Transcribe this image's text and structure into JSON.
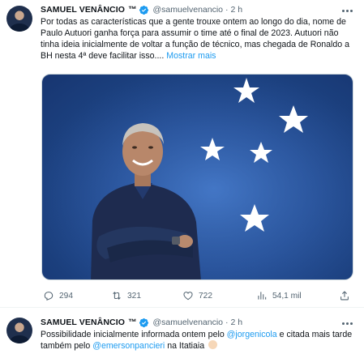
{
  "tweets": [
    {
      "author_name": "SAMUEL VENÂNCIO",
      "author_tm": "™",
      "handle": "@samuelvenancio",
      "separator": "·",
      "time": "2 h",
      "text": "Por todas as características que a gente trouxe ontem ao longo do dia, nome de Paulo Autuori ganha força para assumir o time até o final de 2023. Autuori não tinha ideia inicialmente de voltar a função de técnico, mas chegada de Ronaldo a BH nesta 4ª deve facilitar isso....",
      "show_more": "Mostrar mais",
      "replies": "294",
      "retweets": "321",
      "likes": "722",
      "views": "54,1 mil"
    },
    {
      "author_name": "SAMUEL VENÂNCIO",
      "author_tm": "™",
      "handle": "@samuelvenancio",
      "separator": "·",
      "time": "2 h",
      "text_part1": "Possibilidade inicialmente informada ontem pelo ",
      "mention1": "@jorgenicola",
      "text_part2": " e citada mais tarde também pelo ",
      "mention2": "@emersonpancieri",
      "text_part3": " na Itatiaia"
    }
  ],
  "icons": {
    "verified": "verified-badge-icon",
    "more": "more-options-icon",
    "reply": "reply-icon",
    "retweet": "retweet-icon",
    "like": "heart-icon",
    "views": "views-chart-icon",
    "share": "share-icon",
    "emoji": "clap-emoji-icon"
  },
  "colors": {
    "accent": "#1d9bf0",
    "secondary_text": "#536471",
    "primary_text": "#0f1419"
  }
}
